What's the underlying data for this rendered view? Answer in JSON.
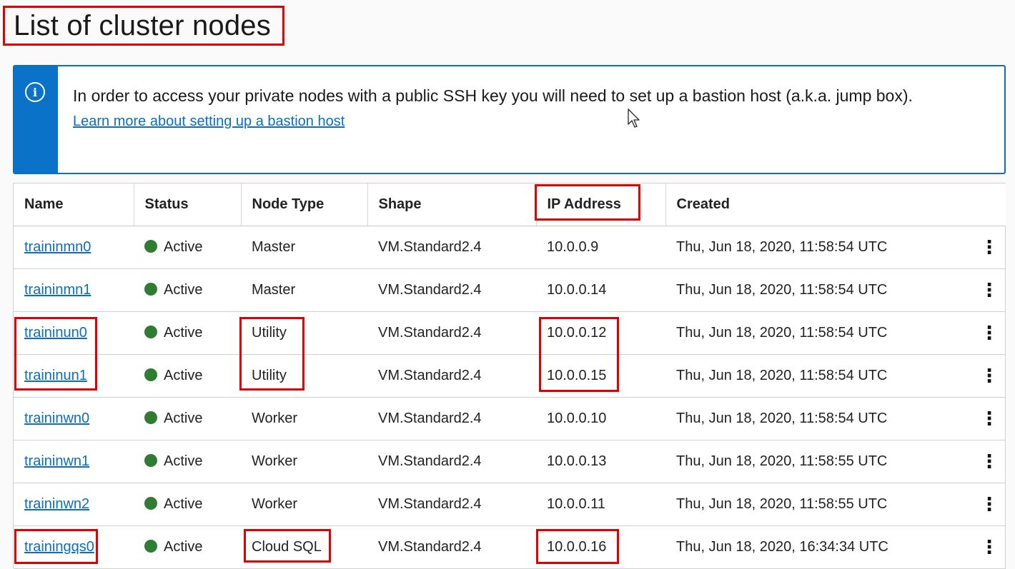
{
  "page": {
    "title": "List of cluster nodes"
  },
  "notice": {
    "icon": "info-icon",
    "text": "In order to access your private nodes with a public SSH key you will need to set up a bastion host (a.k.a. jump box).",
    "link": "Learn more about setting up a bastion host"
  },
  "table": {
    "columns": [
      "Name",
      "Status",
      "Node Type",
      "Shape",
      "IP Address",
      "Created"
    ],
    "rows": [
      {
        "name": "traininmn0",
        "status": "Active",
        "type": "Master",
        "shape": "VM.Standard2.4",
        "ip": "10.0.0.9",
        "created": "Thu, Jun 18, 2020, 11:58:54 UTC"
      },
      {
        "name": "traininmn1",
        "status": "Active",
        "type": "Master",
        "shape": "VM.Standard2.4",
        "ip": "10.0.0.14",
        "created": "Thu, Jun 18, 2020, 11:58:54 UTC"
      },
      {
        "name": "traininun0",
        "status": "Active",
        "type": "Utility",
        "shape": "VM.Standard2.4",
        "ip": "10.0.0.12",
        "created": "Thu, Jun 18, 2020, 11:58:54 UTC"
      },
      {
        "name": "traininun1",
        "status": "Active",
        "type": "Utility",
        "shape": "VM.Standard2.4",
        "ip": "10.0.0.15",
        "created": "Thu, Jun 18, 2020, 11:58:54 UTC"
      },
      {
        "name": "traininwn0",
        "status": "Active",
        "type": "Worker",
        "shape": "VM.Standard2.4",
        "ip": "10.0.0.10",
        "created": "Thu, Jun 18, 2020, 11:58:54 UTC"
      },
      {
        "name": "traininwn1",
        "status": "Active",
        "type": "Worker",
        "shape": "VM.Standard2.4",
        "ip": "10.0.0.13",
        "created": "Thu, Jun 18, 2020, 11:58:55 UTC"
      },
      {
        "name": "traininwn2",
        "status": "Active",
        "type": "Worker",
        "shape": "VM.Standard2.4",
        "ip": "10.0.0.11",
        "created": "Thu, Jun 18, 2020, 11:58:55 UTC"
      },
      {
        "name": "trainingqs0",
        "status": "Active",
        "type": "Cloud SQL",
        "shape": "VM.Standard2.4",
        "ip": "10.0.0.16",
        "created": "Thu, Jun 18, 2020, 16:34:34 UTC"
      }
    ],
    "row_action_icon": "kebab-menu-icon",
    "status_color": "#2e7d32"
  },
  "colors": {
    "accent": "#0b72c9",
    "highlight": "#e00000",
    "link": "#0b6fbe"
  }
}
